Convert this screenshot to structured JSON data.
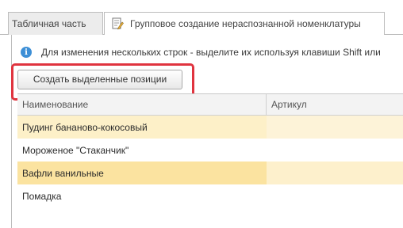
{
  "tabs": [
    {
      "label": "Табличная часть",
      "active": false
    },
    {
      "label": "Групповое создание нераспознанной номенклатуры",
      "active": true
    }
  ],
  "info": {
    "icon": "info-icon",
    "text": "Для изменения нескольких строк - выделите их используя клавиши Shift или"
  },
  "toolbar": {
    "create_label": "Создать выделенные позиции"
  },
  "table": {
    "columns": [
      "Наименование",
      "Артикул"
    ],
    "rows": [
      {
        "name": "Пудинг бананово-кокосовый",
        "article": "",
        "selected": true
      },
      {
        "name": "Мороженое \"Стаканчик\"",
        "article": "",
        "selected": false
      },
      {
        "name": "Вафли ванильные",
        "article": "",
        "selected": true
      },
      {
        "name": "Помадка",
        "article": "",
        "selected": false
      }
    ]
  },
  "colors": {
    "highlight_frame": "#e0343f",
    "info_icon": "#3d8fd6",
    "selected_row": "#fbe3a0"
  }
}
